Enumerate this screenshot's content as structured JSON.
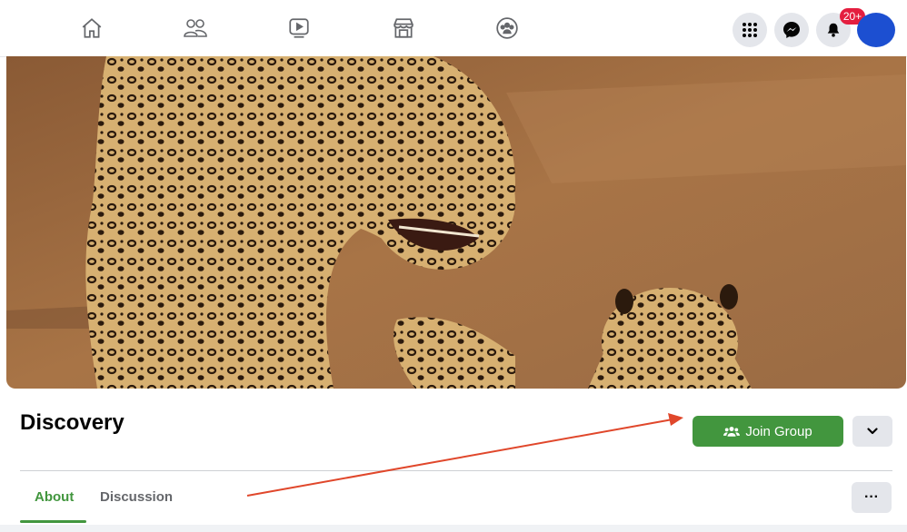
{
  "topbar": {
    "nav_icons": [
      "home-icon",
      "friends-icon",
      "watch-icon",
      "marketplace-icon",
      "groups-icon"
    ],
    "right_icons": [
      "menu-grid-icon",
      "messenger-icon",
      "notifications-icon"
    ],
    "notification_badge": "20+",
    "avatar_color": "#1c4fd1"
  },
  "cover": {
    "description_icon": "leopards-photo",
    "primary_color": "#a06c3a"
  },
  "group": {
    "name": "Discovery",
    "join_label": "Join Group",
    "join_icon": "group-people-icon",
    "accent_color": "#42963e"
  },
  "tabs": [
    {
      "label": "About",
      "active": true
    },
    {
      "label": "Discussion",
      "active": false
    }
  ],
  "more_label": "···",
  "annotation": {
    "arrow_color": "#e0472b"
  }
}
